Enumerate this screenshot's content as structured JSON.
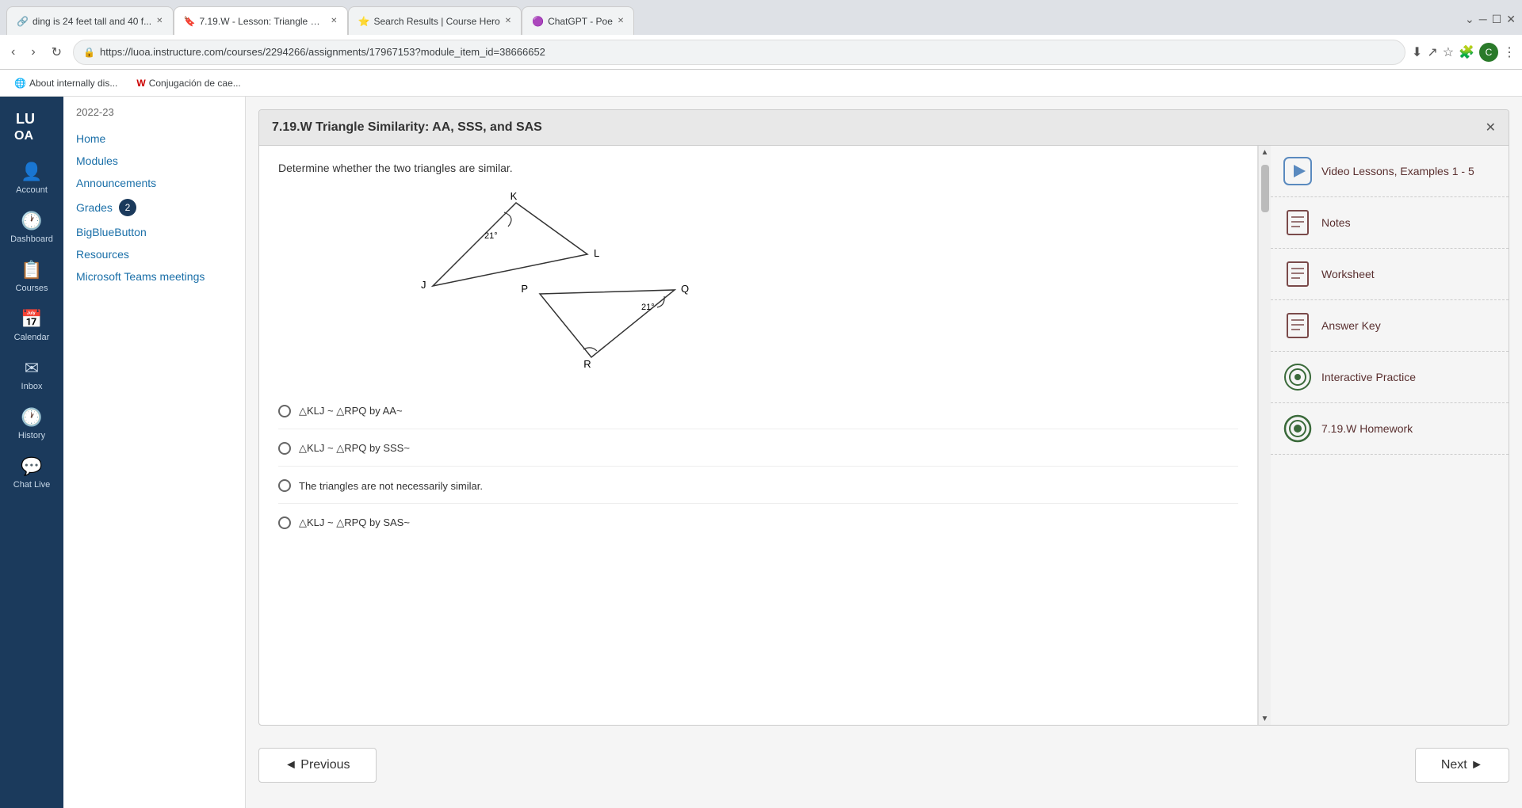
{
  "browser": {
    "tabs": [
      {
        "id": "tab1",
        "title": "ding is 24 feet tall and 40 f...",
        "favicon": "🔗",
        "active": false
      },
      {
        "id": "tab2",
        "title": "7.19.W - Lesson: Triangle Similari...",
        "favicon": "🔖",
        "active": true
      },
      {
        "id": "tab3",
        "title": "Search Results | Course Hero",
        "favicon": "⭐",
        "active": false
      },
      {
        "id": "tab4",
        "title": "ChatGPT - Poe",
        "favicon": "🟣",
        "active": false
      }
    ],
    "url": "https://luoa.instructure.com/courses/2294266/assignments/17967153?module_item_id=38666652",
    "bookmarks": [
      {
        "label": "About internally dis...",
        "icon": "🌐"
      },
      {
        "label": "Conjugación de cae...",
        "icon": "W"
      }
    ]
  },
  "left_nav": {
    "logo_text": "LU OA",
    "items": [
      {
        "id": "account",
        "icon": "👤",
        "label": "Account"
      },
      {
        "id": "dashboard",
        "icon": "🕐",
        "label": "Dashboard"
      },
      {
        "id": "courses",
        "icon": "📋",
        "label": "Courses"
      },
      {
        "id": "calendar",
        "icon": "📅",
        "label": "Calendar"
      },
      {
        "id": "inbox",
        "icon": "✉",
        "label": "Inbox"
      },
      {
        "id": "history",
        "icon": "🕐",
        "label": "History"
      },
      {
        "id": "chat_live",
        "icon": "💬",
        "label": "Chat Live"
      }
    ]
  },
  "course_sidebar": {
    "year": "2022-23",
    "links": [
      {
        "id": "home",
        "label": "Home",
        "badge": null
      },
      {
        "id": "modules",
        "label": "Modules",
        "badge": null
      },
      {
        "id": "announcements",
        "label": "Announcements",
        "badge": null
      },
      {
        "id": "grades",
        "label": "Grades",
        "badge": "2"
      },
      {
        "id": "bigbluebutton",
        "label": "BigBlueButton",
        "badge": null
      },
      {
        "id": "resources",
        "label": "Resources",
        "badge": null
      },
      {
        "id": "microsoft_teams",
        "label": "Microsoft Teams meetings",
        "badge": null
      }
    ]
  },
  "assignment": {
    "title": "7.19.W Triangle Similarity: AA, SSS, and SAS",
    "question_text": "Determine whether the two triangles are similar.",
    "answer_choices": [
      {
        "id": "a",
        "text": "△KLJ ~ △RPQ by AA~"
      },
      {
        "id": "b",
        "text": "△KLJ ~ △RPQ by SSS~"
      },
      {
        "id": "c",
        "text": "The triangles are not necessarily similar."
      },
      {
        "id": "d",
        "text": "△KLJ ~ △RPQ by SAS~"
      }
    ],
    "right_sidebar": [
      {
        "id": "video",
        "label": "Video Lessons, Examples 1 - 5",
        "icon_type": "play"
      },
      {
        "id": "notes",
        "label": "Notes",
        "icon_type": "doc"
      },
      {
        "id": "worksheet",
        "label": "Worksheet",
        "icon_type": "doc"
      },
      {
        "id": "answer_key",
        "label": "Answer Key",
        "icon_type": "doc"
      },
      {
        "id": "interactive",
        "label": "Interactive Practice",
        "icon_type": "target"
      },
      {
        "id": "homework",
        "label": "7.19.W Homework",
        "icon_type": "target-filled"
      }
    ]
  },
  "navigation": {
    "previous_label": "◄ Previous",
    "next_label": "Next ►"
  }
}
